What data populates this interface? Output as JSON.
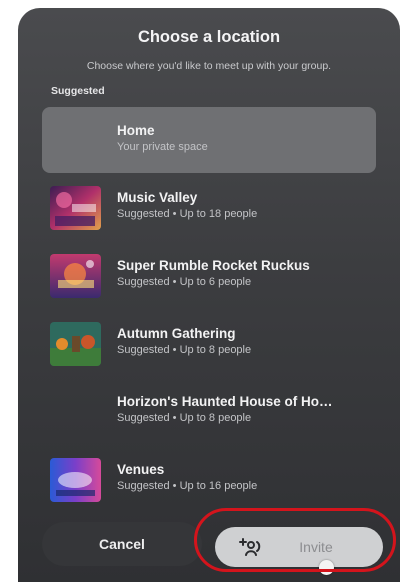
{
  "dialog": {
    "title": "Choose a location",
    "subtitle": "Choose where you'd like to meet up with your group.",
    "section_label": "Suggested"
  },
  "locations": [
    {
      "name": "Home",
      "subtitle": "Your private space",
      "selected": true
    },
    {
      "name": "Music Valley",
      "subtitle": "Suggested • Up to 18 people",
      "selected": false
    },
    {
      "name": "Super Rumble Rocket Ruckus",
      "subtitle": "Suggested • Up to 6 people",
      "selected": false
    },
    {
      "name": "Autumn Gathering",
      "subtitle": "Suggested • Up to 8 people",
      "selected": false
    },
    {
      "name": "Horizon's Haunted House of Ho…",
      "subtitle": "Suggested • Up to 8 people",
      "selected": false
    },
    {
      "name": "Venues",
      "subtitle": "Suggested • Up to 16 people",
      "selected": false
    }
  ],
  "footer": {
    "cancel_label": "Cancel",
    "invite_label": "Invite"
  },
  "icons": {
    "invite": "add-people-icon"
  },
  "colors": {
    "panel_bg": "#3c3d40",
    "selected_row": "#6f7073",
    "invite_button": "#cfd0d2",
    "highlight": "#d4141c"
  }
}
